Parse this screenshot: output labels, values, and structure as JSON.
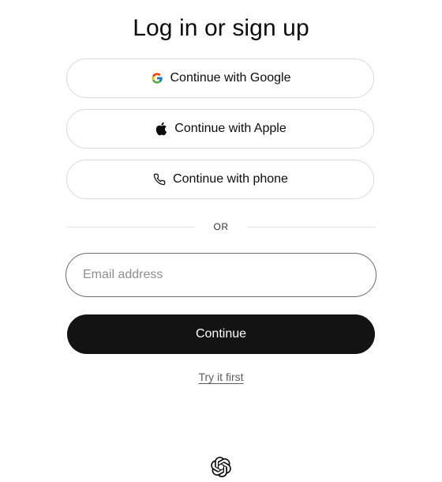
{
  "title": "Log in or sign up",
  "oauth": {
    "google_label": "Continue with Google",
    "apple_label": "Continue with Apple",
    "phone_label": "Continue with phone"
  },
  "divider_text": "OR",
  "email": {
    "placeholder": "Email address",
    "value": ""
  },
  "continue_label": "Continue",
  "try_label": "Try it first",
  "icons": {
    "google": "google-icon",
    "apple": "apple-icon",
    "phone": "phone-icon",
    "logo": "openai-logo-icon"
  },
  "colors": {
    "primary_button": "#131313",
    "border": "#d9d9d9",
    "input_border": "#6b6b6b"
  }
}
